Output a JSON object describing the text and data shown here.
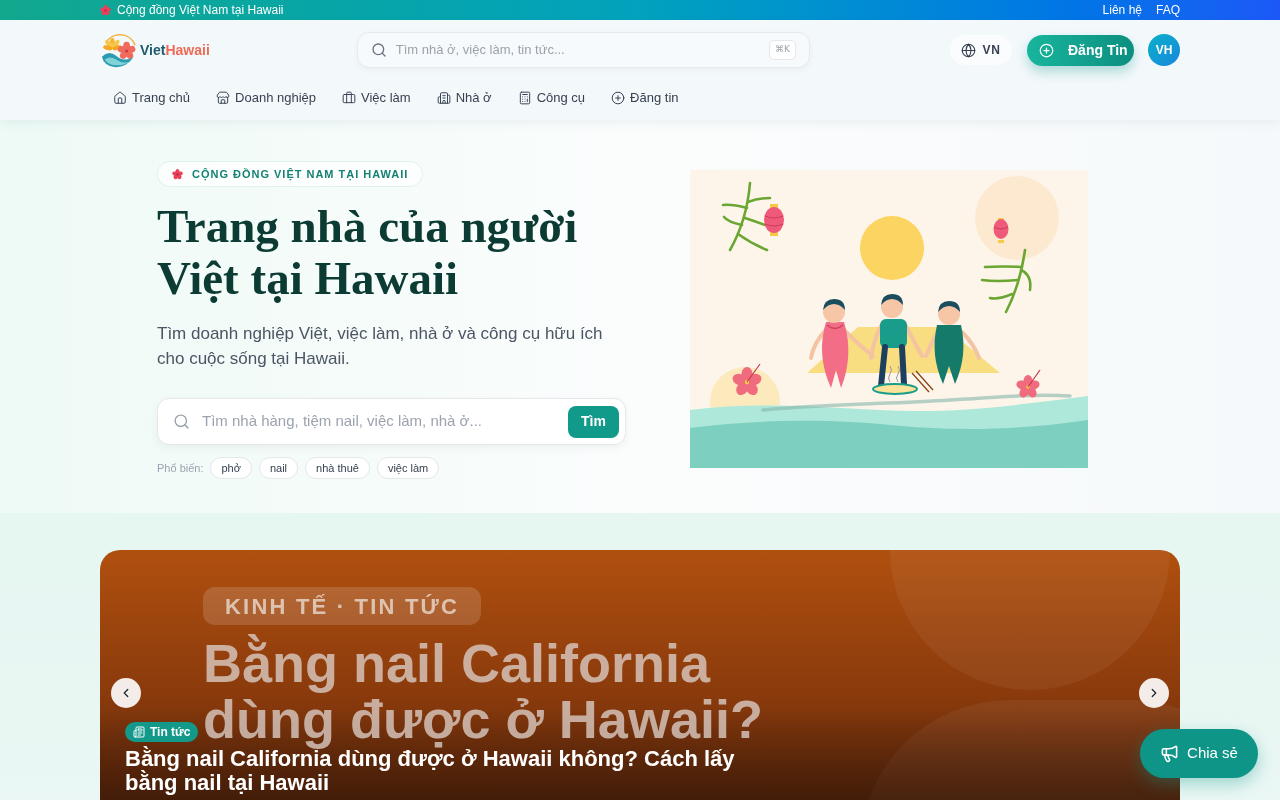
{
  "top_bar": {
    "text": "Cộng đồng Việt Nam tại Hawaii",
    "links": [
      "Liên hệ",
      "FAQ"
    ]
  },
  "header": {
    "logo": {
      "first": "Viet",
      "second": "Hawaii"
    },
    "search": {
      "placeholder": "Tìm nhà ở, việc làm, tin tức...",
      "shortcut": "⌘K"
    },
    "language": "VN",
    "post_button": "Đăng Tin",
    "avatar": "VH"
  },
  "nav": [
    {
      "label": "Trang chủ"
    },
    {
      "label": "Doanh nghiệp"
    },
    {
      "label": "Việc làm"
    },
    {
      "label": "Nhà ở"
    },
    {
      "label": "Công cụ"
    },
    {
      "label": "Đăng tin"
    }
  ],
  "hero": {
    "badge": "CỘNG ĐỒNG VIỆT NAM TẠI HAWAII",
    "title": "Trang nhà của người Việt tại Hawaii",
    "subtitle": "Tìm doanh nghiệp Việt, việc làm, nhà ở và công cụ hữu ích cho cuộc sống tại Hawaii.",
    "search": {
      "placeholder": "Tìm nhà hàng, tiệm nail, việc làm, nhà ở...",
      "button": "Tìm"
    },
    "popular_label": "Phổ biến:",
    "popular_tags": [
      "phở",
      "nail",
      "nhà thuê",
      "việc làm"
    ]
  },
  "featured": {
    "cover": {
      "tag": "KINH TẾ · TIN TỨC",
      "title": "Bằng nail California dùng được ở Hawaii?"
    },
    "category": "Tin tức",
    "headline": "Bằng nail California dùng được ở Hawaii không? Cách lấy bằng nail tại Hawaii"
  },
  "share_button": "Chia sẻ"
}
